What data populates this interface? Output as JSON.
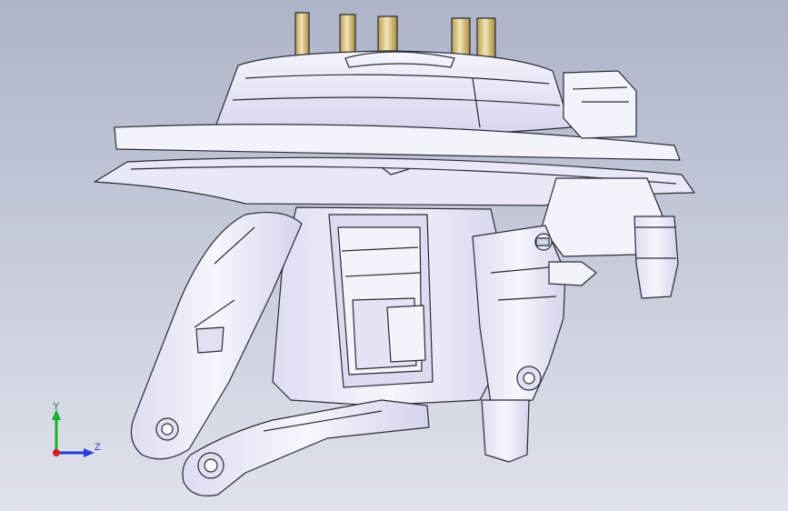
{
  "colors": {
    "background_top": "#aeb4c8",
    "background_bottom": "#e0e3ec",
    "part_fill": "#f3f3fb",
    "part_shade": "#d9d8f0",
    "part_edge": "#2a2a35",
    "pin_fill": "#e3d39a",
    "pin_shade": "#b89d4f",
    "axis_y": "#1cb02c",
    "axis_z": "#2a3cd8",
    "axis_x": "#d81e1e"
  },
  "triad": {
    "y_label": "Y",
    "z_label": "Z"
  }
}
